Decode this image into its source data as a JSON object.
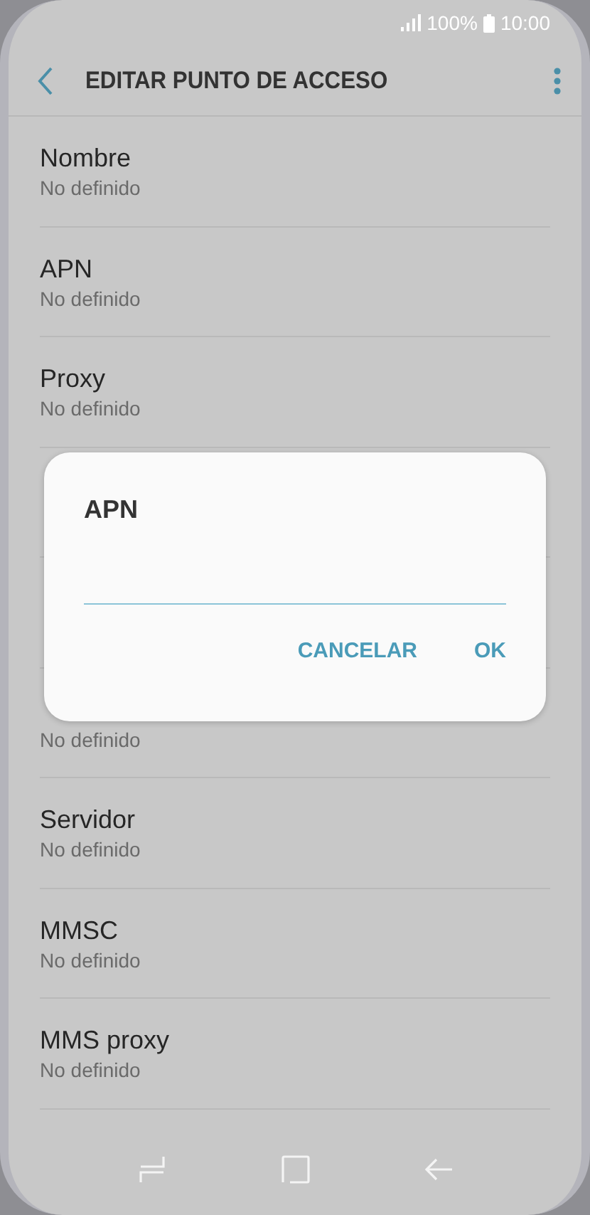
{
  "status_bar": {
    "battery": "100%",
    "time": "10:00"
  },
  "header": {
    "title": "EDITAR PUNTO DE ACCESO"
  },
  "items": [
    {
      "title": "Nombre",
      "value": "No definido"
    },
    {
      "title": "APN",
      "value": "No definido"
    },
    {
      "title": "Proxy",
      "value": "No definido"
    },
    {
      "value": "No definido"
    },
    {
      "title": "Servidor",
      "value": "No definido"
    },
    {
      "title": "MMSC",
      "value": "No definido"
    },
    {
      "title": "MMS proxy",
      "value": "No definido"
    }
  ],
  "dialog": {
    "title": "APN",
    "buttons": [
      "CANCELAR",
      "OK"
    ]
  }
}
